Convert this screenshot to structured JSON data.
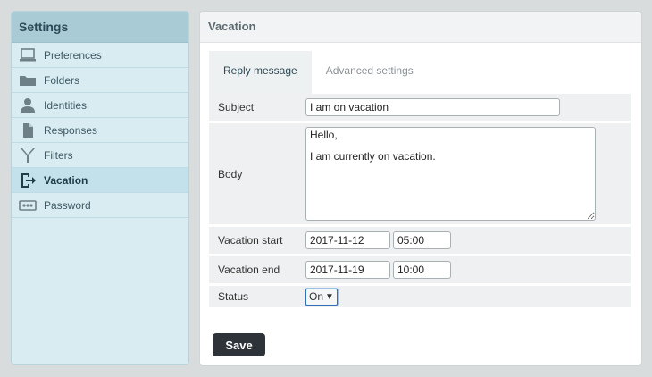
{
  "sidebar": {
    "title": "Settings",
    "items": [
      {
        "label": "Preferences",
        "icon": "laptop-icon",
        "active": false
      },
      {
        "label": "Folders",
        "icon": "folder-icon",
        "active": false
      },
      {
        "label": "Identities",
        "icon": "user-icon",
        "active": false
      },
      {
        "label": "Responses",
        "icon": "document-icon",
        "active": false
      },
      {
        "label": "Filters",
        "icon": "filter-icon",
        "active": false
      },
      {
        "label": "Vacation",
        "icon": "logout-icon",
        "active": true
      },
      {
        "label": "Password",
        "icon": "password-icon",
        "active": false
      }
    ]
  },
  "main": {
    "title": "Vacation",
    "tabs": [
      {
        "label": "Reply message",
        "active": true
      },
      {
        "label": "Advanced settings",
        "active": false
      }
    ],
    "form": {
      "subject_label": "Subject",
      "subject_value": "I am on vacation",
      "body_label": "Body",
      "body_value": "Hello,\n\nI am currently on vacation.",
      "start_label": "Vacation start",
      "start_date": "2017-11-12",
      "start_time": "05:00",
      "end_label": "Vacation end",
      "end_date": "2017-11-19",
      "end_time": "10:00",
      "status_label": "Status",
      "status_value": "On"
    },
    "save_label": "Save"
  }
}
